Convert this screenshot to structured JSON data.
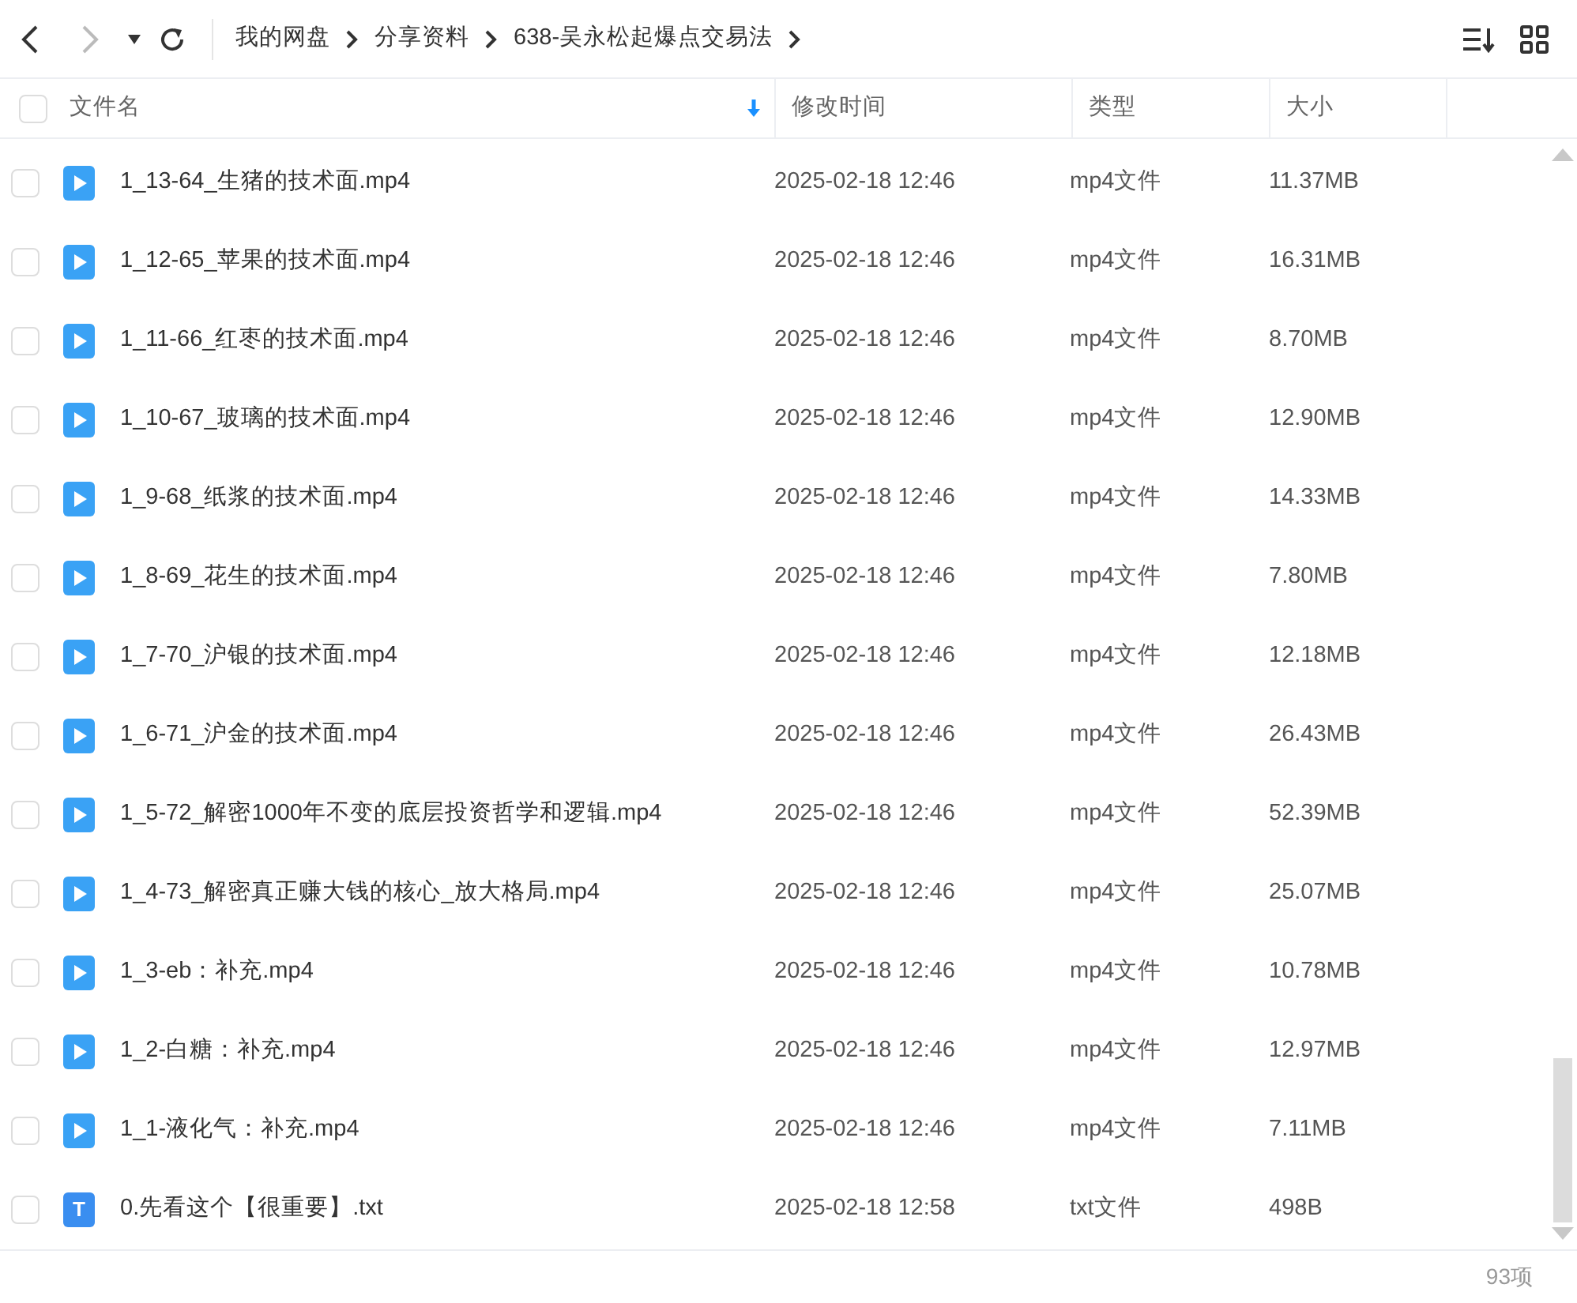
{
  "breadcrumbs": [
    "我的网盘",
    "分享资料",
    "638-吴永松起爆点交易法"
  ],
  "select_all": {
    "checked": false
  },
  "columns": [
    "文件名",
    "修改时间",
    "类型",
    "大小"
  ],
  "files": [
    {
      "kind": "video",
      "name": "1_13-64_生猪的技术面.mp4",
      "modified": "2025-02-18 12:46",
      "type": "mp4文件",
      "size": "11.37MB",
      "selected": false
    },
    {
      "kind": "video",
      "name": "1_12-65_苹果的技术面.mp4",
      "modified": "2025-02-18 12:46",
      "type": "mp4文件",
      "size": "16.31MB",
      "selected": false
    },
    {
      "kind": "video",
      "name": "1_11-66_红枣的技术面.mp4",
      "modified": "2025-02-18 12:46",
      "type": "mp4文件",
      "size": "8.70MB",
      "selected": false
    },
    {
      "kind": "video",
      "name": "1_10-67_玻璃的技术面.mp4",
      "modified": "2025-02-18 12:46",
      "type": "mp4文件",
      "size": "12.90MB",
      "selected": false
    },
    {
      "kind": "video",
      "name": "1_9-68_纸浆的技术面.mp4",
      "modified": "2025-02-18 12:46",
      "type": "mp4文件",
      "size": "14.33MB",
      "selected": false
    },
    {
      "kind": "video",
      "name": "1_8-69_花生的技术面.mp4",
      "modified": "2025-02-18 12:46",
      "type": "mp4文件",
      "size": "7.80MB",
      "selected": false
    },
    {
      "kind": "video",
      "name": "1_7-70_沪银的技术面.mp4",
      "modified": "2025-02-18 12:46",
      "type": "mp4文件",
      "size": "12.18MB",
      "selected": false
    },
    {
      "kind": "video",
      "name": "1_6-71_沪金的技术面.mp4",
      "modified": "2025-02-18 12:46",
      "type": "mp4文件",
      "size": "26.43MB",
      "selected": false
    },
    {
      "kind": "video",
      "name": "1_5-72_解密1000年不变的底层投资哲学和逻辑.mp4",
      "modified": "2025-02-18 12:46",
      "type": "mp4文件",
      "size": "52.39MB",
      "selected": false
    },
    {
      "kind": "video",
      "name": "1_4-73_解密真正赚大钱的核心_放大格局.mp4",
      "modified": "2025-02-18 12:46",
      "type": "mp4文件",
      "size": "25.07MB",
      "selected": false
    },
    {
      "kind": "video",
      "name": "1_3-eb：补充.mp4",
      "modified": "2025-02-18 12:46",
      "type": "mp4文件",
      "size": "10.78MB",
      "selected": false
    },
    {
      "kind": "video",
      "name": "1_2-白糖：补充.mp4",
      "modified": "2025-02-18 12:46",
      "type": "mp4文件",
      "size": "12.97MB",
      "selected": false
    },
    {
      "kind": "video",
      "name": "1_1-液化气：补充.mp4",
      "modified": "2025-02-18 12:46",
      "type": "mp4文件",
      "size": "7.11MB",
      "selected": false
    },
    {
      "kind": "text",
      "icon_letter": "T",
      "name": "0.先看这个【很重要】.txt",
      "modified": "2025-02-18 12:58",
      "type": "txt文件",
      "size": "498B",
      "selected": false
    }
  ],
  "item_count": "93项"
}
